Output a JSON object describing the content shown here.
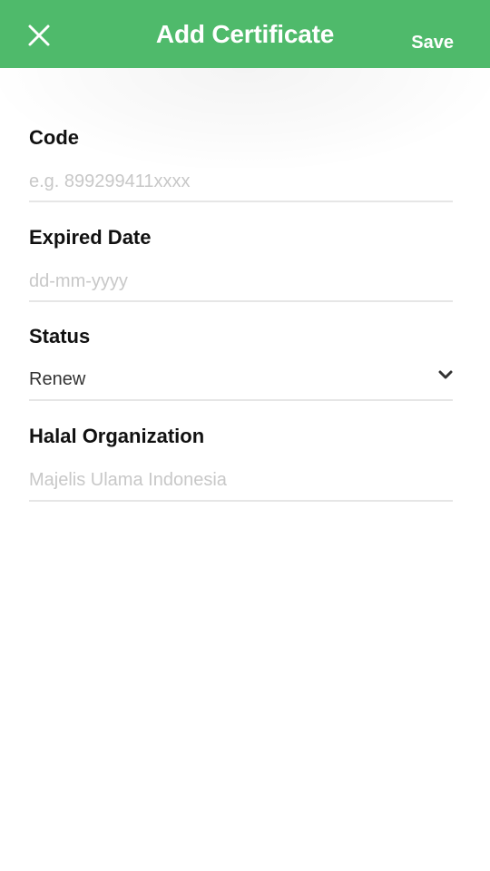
{
  "header": {
    "title": "Add Certificate",
    "save_label": "Save",
    "close_icon": "close-icon",
    "background_color": "#4fba6b",
    "text_color": "#ffffff"
  },
  "form": {
    "code": {
      "label": "Code",
      "placeholder": "e.g. 899299411xxxx",
      "value": ""
    },
    "expired_date": {
      "label": "Expired Date",
      "placeholder": "dd-mm-yyyy",
      "value": ""
    },
    "status": {
      "label": "Status",
      "selected": "Renew",
      "icon": "chevron-down-icon"
    },
    "halal_organization": {
      "label": "Halal Organization",
      "placeholder": "Majelis Ulama Indonesia",
      "value": ""
    }
  }
}
